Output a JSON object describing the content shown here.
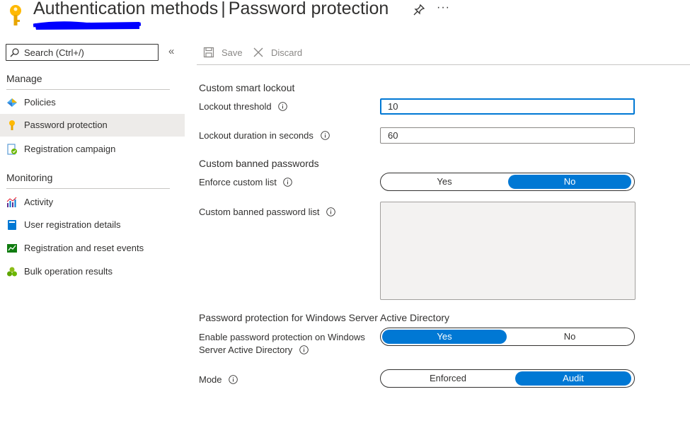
{
  "header": {
    "title": "Authentication methods",
    "separator": "|",
    "subtitle": "Password protection",
    "pin_icon": "pin-icon",
    "more_label": "···",
    "redaction_color": "#0000ff",
    "key_icon_color": "#ffb900"
  },
  "sidebar": {
    "search": {
      "placeholder": "Search (Ctrl+/)"
    },
    "collapse_label": "«",
    "sections": {
      "manage": {
        "title": "Manage",
        "items": [
          {
            "label": "Policies",
            "icon": "policies-icon"
          },
          {
            "label": "Password protection",
            "icon": "key-icon",
            "active": true
          },
          {
            "label": "Registration campaign",
            "icon": "registration-campaign-icon"
          }
        ]
      },
      "monitoring": {
        "title": "Monitoring",
        "items": [
          {
            "label": "Activity",
            "icon": "activity-chart-icon"
          },
          {
            "label": "User registration details",
            "icon": "user-details-icon"
          },
          {
            "label": "Registration and reset events",
            "icon": "events-icon"
          },
          {
            "label": "Bulk operation results",
            "icon": "bulk-operation-icon"
          }
        ]
      }
    }
  },
  "toolbar": {
    "save_label": "Save",
    "discard_label": "Discard"
  },
  "form": {
    "smart_lockout": {
      "title": "Custom smart lockout",
      "threshold_label": "Lockout threshold",
      "threshold_value": "10",
      "duration_label": "Lockout duration in seconds",
      "duration_value": "60"
    },
    "banned_passwords": {
      "title": "Custom banned passwords",
      "enforce_label": "Enforce custom list",
      "enforce_options": [
        "Yes",
        "No"
      ],
      "enforce_selected": "No",
      "list_label": "Custom banned password list",
      "list_value": ""
    },
    "windows_ad": {
      "title": "Password protection for Windows Server Active Directory",
      "enable_label_line1": "Enable password protection on Windows",
      "enable_label_line2": "Server Active Directory",
      "enable_options": [
        "Yes",
        "No"
      ],
      "enable_selected": "Yes",
      "mode_label": "Mode",
      "mode_options": [
        "Enforced",
        "Audit"
      ],
      "mode_selected": "Audit"
    }
  },
  "colors": {
    "accent": "#0078d4",
    "active_nav_bg": "#edebe9",
    "disabled_text": "#8a8886"
  }
}
